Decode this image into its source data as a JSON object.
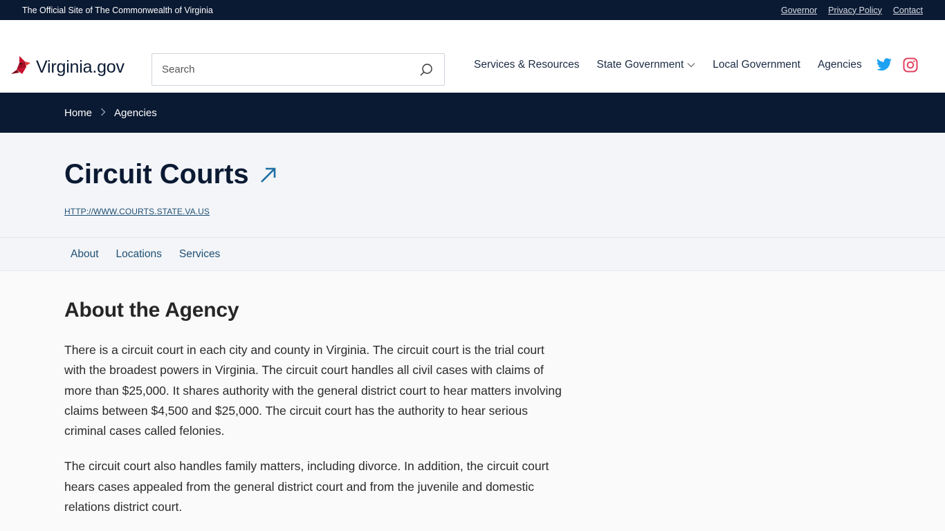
{
  "utility": {
    "official_text": "The Official Site of The Commonwealth of Virginia",
    "links": [
      "Governor",
      "Privacy Policy",
      "Contact"
    ]
  },
  "header": {
    "logo_text": "Virginia.gov",
    "search_placeholder": "Search",
    "nav": [
      "Services & Resources",
      "State Government",
      "Local Government",
      "Agencies"
    ],
    "social_icons": [
      "twitter-icon",
      "instagram-icon"
    ]
  },
  "breadcrumb": [
    "Home",
    "Agencies"
  ],
  "agency": {
    "title": "Circuit Courts",
    "url": "HTTP://WWW.COURTS.STATE.VA.US"
  },
  "tabs": [
    "About",
    "Locations",
    "Services"
  ],
  "about": {
    "heading": "About the Agency",
    "paragraphs": [
      "There is a circuit court in each city and county in Virginia. The circuit court is the trial court with the broadest powers in Virginia. The circuit court handles all civil cases with claims of more than $25,000. It shares authority with the general district court to hear matters involving claims between $4,500 and $25,000. The circuit court has the authority to hear serious criminal cases called felonies.",
      "The circuit court also handles family matters, including divorce. In addition, the circuit court hears cases appealed from the general district court and from the juvenile and domestic relations district court."
    ]
  },
  "colors": {
    "navy": "#0b1a33",
    "link": "#1f4f73",
    "twitter": "#1da1f2",
    "instagram": "#e4405f",
    "cardinal": "#c8102e"
  }
}
